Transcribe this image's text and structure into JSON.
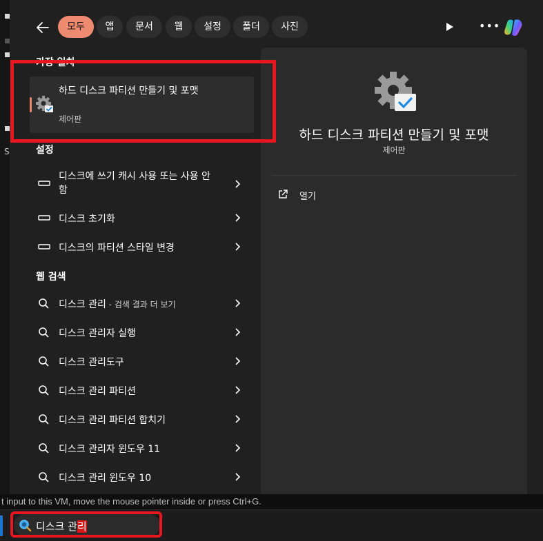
{
  "filters": [
    "모두",
    "앱",
    "문서",
    "웹",
    "설정",
    "폴더",
    "사진"
  ],
  "best_match": {
    "section_label": "가장 일치",
    "title": "하드 디스크 파티션 만들기 및 포맷",
    "subtitle": "제어판"
  },
  "settings": {
    "section_label": "설정",
    "items": [
      "디스크에 쓰기 캐시 사용 또는 사용 안 함",
      "디스크 초기화",
      "디스크의 파티션 스타일 변경"
    ]
  },
  "web": {
    "section_label": "웹 검색",
    "first": {
      "query": "디스크 관리",
      "suffix": " - 검색 결과 더 보기"
    },
    "items": [
      "디스크 관리자 실행",
      "디스크 관리도구",
      "디스크 관리 파티션",
      "디스크 관리 파티션 합치기",
      "디스크 관리자 윈도우 11",
      "디스크 관리 윈도우 10"
    ]
  },
  "detail": {
    "title": "하드 디스크 파티션 만들기 및 포맷",
    "subtitle": "제어판",
    "action_open": "열기"
  },
  "vm_hint": "t input to this VM, move the mouse pointer inside or press Ctrl+G.",
  "taskbar": {
    "search_text": "디스크 관",
    "search_selected": "리"
  },
  "left_edge_text": "SI",
  "colors": {
    "accent": "#ee8a6f",
    "highlight_box": "#e8161f",
    "panel_bg": "#202020",
    "detail_bg": "#2b2b2b"
  },
  "icons": [
    "back-arrow-icon",
    "play-icon",
    "more-icon",
    "copilot-icon",
    "control-panel-gear-icon",
    "device-icon",
    "search-icon",
    "chevron-right-icon",
    "open-external-icon"
  ]
}
